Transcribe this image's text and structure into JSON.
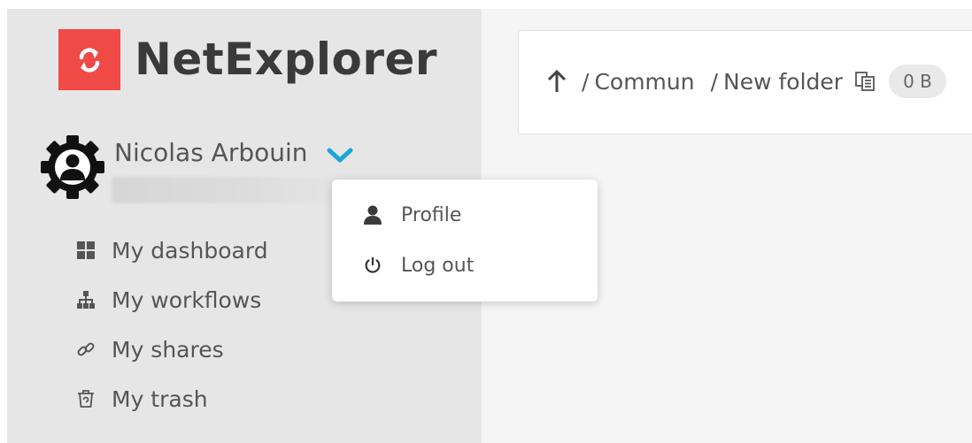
{
  "app": {
    "logo_text": "NetExplorer",
    "brand_color": "#f04a47"
  },
  "user": {
    "name": "Nicolas Arbouin",
    "chevron_color": "#1aa6d8",
    "avatar_icon": "user-gear-icon"
  },
  "sidebar": {
    "items": [
      {
        "label": "My dashboard",
        "icon": "dashboard-grid-icon"
      },
      {
        "label": "My workflows",
        "icon": "workflow-tree-icon"
      },
      {
        "label": "My shares",
        "icon": "link-icon"
      },
      {
        "label": "My trash",
        "icon": "trash-icon"
      }
    ]
  },
  "header": {
    "separator": "/",
    "breadcrumbs": [
      "Commun",
      "New folder"
    ],
    "size": "0 B"
  },
  "user_menu": {
    "items": [
      {
        "label": "Profile",
        "icon": "person-icon"
      },
      {
        "label": "Log out",
        "icon": "power-icon"
      }
    ]
  }
}
